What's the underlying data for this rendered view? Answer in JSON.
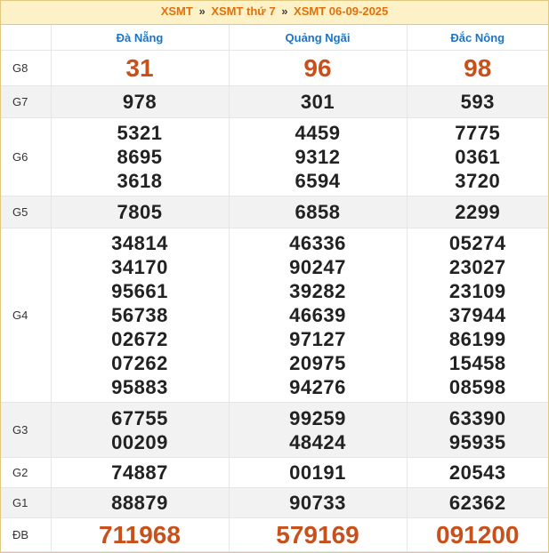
{
  "breadcrumb": {
    "item1": "XSMT",
    "sep1": "»",
    "item2": "XSMT thứ 7",
    "sep2": "»",
    "item3": "XSMT 06-09-2025"
  },
  "provinces": [
    "Đà Nẵng",
    "Quảng Ngãi",
    "Đắc Nông"
  ],
  "prizes": [
    {
      "label": "G8",
      "values": [
        [
          "31"
        ],
        [
          "96"
        ],
        [
          "98"
        ]
      ]
    },
    {
      "label": "G7",
      "values": [
        [
          "978"
        ],
        [
          "301"
        ],
        [
          "593"
        ]
      ]
    },
    {
      "label": "G6",
      "values": [
        [
          "5321",
          "8695",
          "3618"
        ],
        [
          "4459",
          "9312",
          "6594"
        ],
        [
          "7775",
          "0361",
          "3720"
        ]
      ]
    },
    {
      "label": "G5",
      "values": [
        [
          "7805"
        ],
        [
          "6858"
        ],
        [
          "2299"
        ]
      ]
    },
    {
      "label": "G4",
      "values": [
        [
          "34814",
          "34170",
          "95661",
          "56738",
          "02672",
          "07262",
          "95883"
        ],
        [
          "46336",
          "90247",
          "39282",
          "46639",
          "97127",
          "20975",
          "94276"
        ],
        [
          "05274",
          "23027",
          "23109",
          "37944",
          "86199",
          "15458",
          "08598"
        ]
      ]
    },
    {
      "label": "G3",
      "values": [
        [
          "67755",
          "00209"
        ],
        [
          "99259",
          "48424"
        ],
        [
          "63390",
          "95935"
        ]
      ]
    },
    {
      "label": "G2",
      "values": [
        [
          "74887"
        ],
        [
          "00191"
        ],
        [
          "20543"
        ]
      ]
    },
    {
      "label": "G1",
      "values": [
        [
          "88879"
        ],
        [
          "90733"
        ],
        [
          "62362"
        ]
      ]
    },
    {
      "label": "ĐB",
      "values": [
        [
          "711968"
        ],
        [
          "579169"
        ],
        [
          "091200"
        ]
      ]
    }
  ],
  "colors": {
    "accent": "#e0710a",
    "province": "#1d74c5",
    "highlight": "#c8501a"
  }
}
